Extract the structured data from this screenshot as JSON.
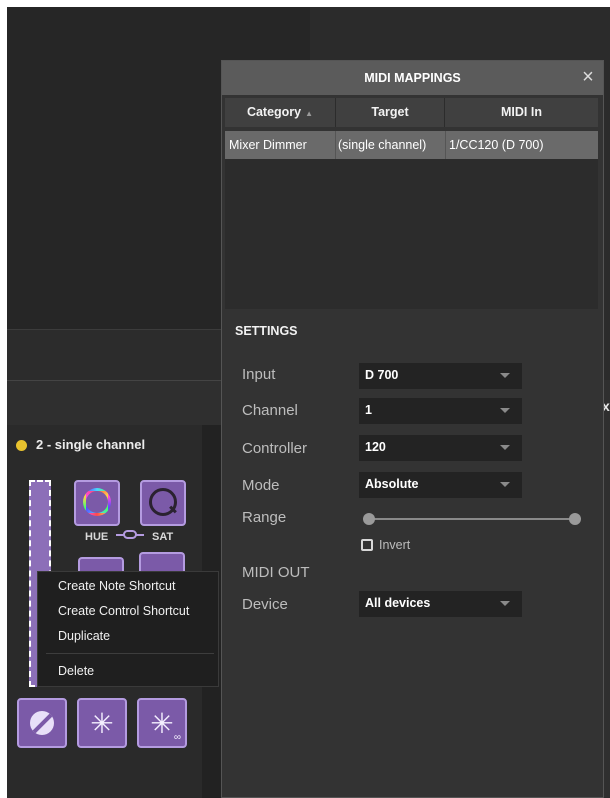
{
  "colors": {
    "accent_purple": "#7b5aa8",
    "channel_dot": "#e8c22e",
    "selected_row": "#6a6a6a",
    "dialog_bg": "#333333"
  },
  "background": {
    "close_glyph": "x"
  },
  "channel": {
    "title": "2 - single channel",
    "hue_label": "HUE",
    "sat_label": "SAT"
  },
  "effects": [
    {
      "icon": "circle-slash-icon"
    },
    {
      "icon": "starburst-icon",
      "glyph": "✳"
    },
    {
      "icon": "starburst-loop-icon",
      "glyph": "✳",
      "sub": "∞"
    }
  ],
  "context_menu": {
    "items": [
      "Create Note Shortcut",
      "Create Control Shortcut",
      "Duplicate",
      "Delete"
    ]
  },
  "dialog": {
    "title": "MIDI MAPPINGS",
    "close_glyph": "×",
    "columns": [
      "Category",
      "Target",
      "MIDI In"
    ],
    "sort_glyph": "▲",
    "rows": [
      {
        "category": "Mixer Dimmer",
        "target": "(single channel)",
        "midi_in": "1/CC120 (D 700)"
      }
    ],
    "settings": {
      "heading": "SETTINGS",
      "input_label": "Input",
      "input_value": "D 700",
      "channel_label": "Channel",
      "channel_value": "1",
      "controller_label": "Controller",
      "controller_value": "120",
      "mode_label": "Mode",
      "mode_value": "Absolute",
      "range_label": "Range",
      "range_min": 0,
      "range_max": 1,
      "invert_label": "Invert",
      "invert_checked": false,
      "midi_out_label": "MIDI OUT",
      "device_label": "Device",
      "device_value": "All devices"
    }
  }
}
